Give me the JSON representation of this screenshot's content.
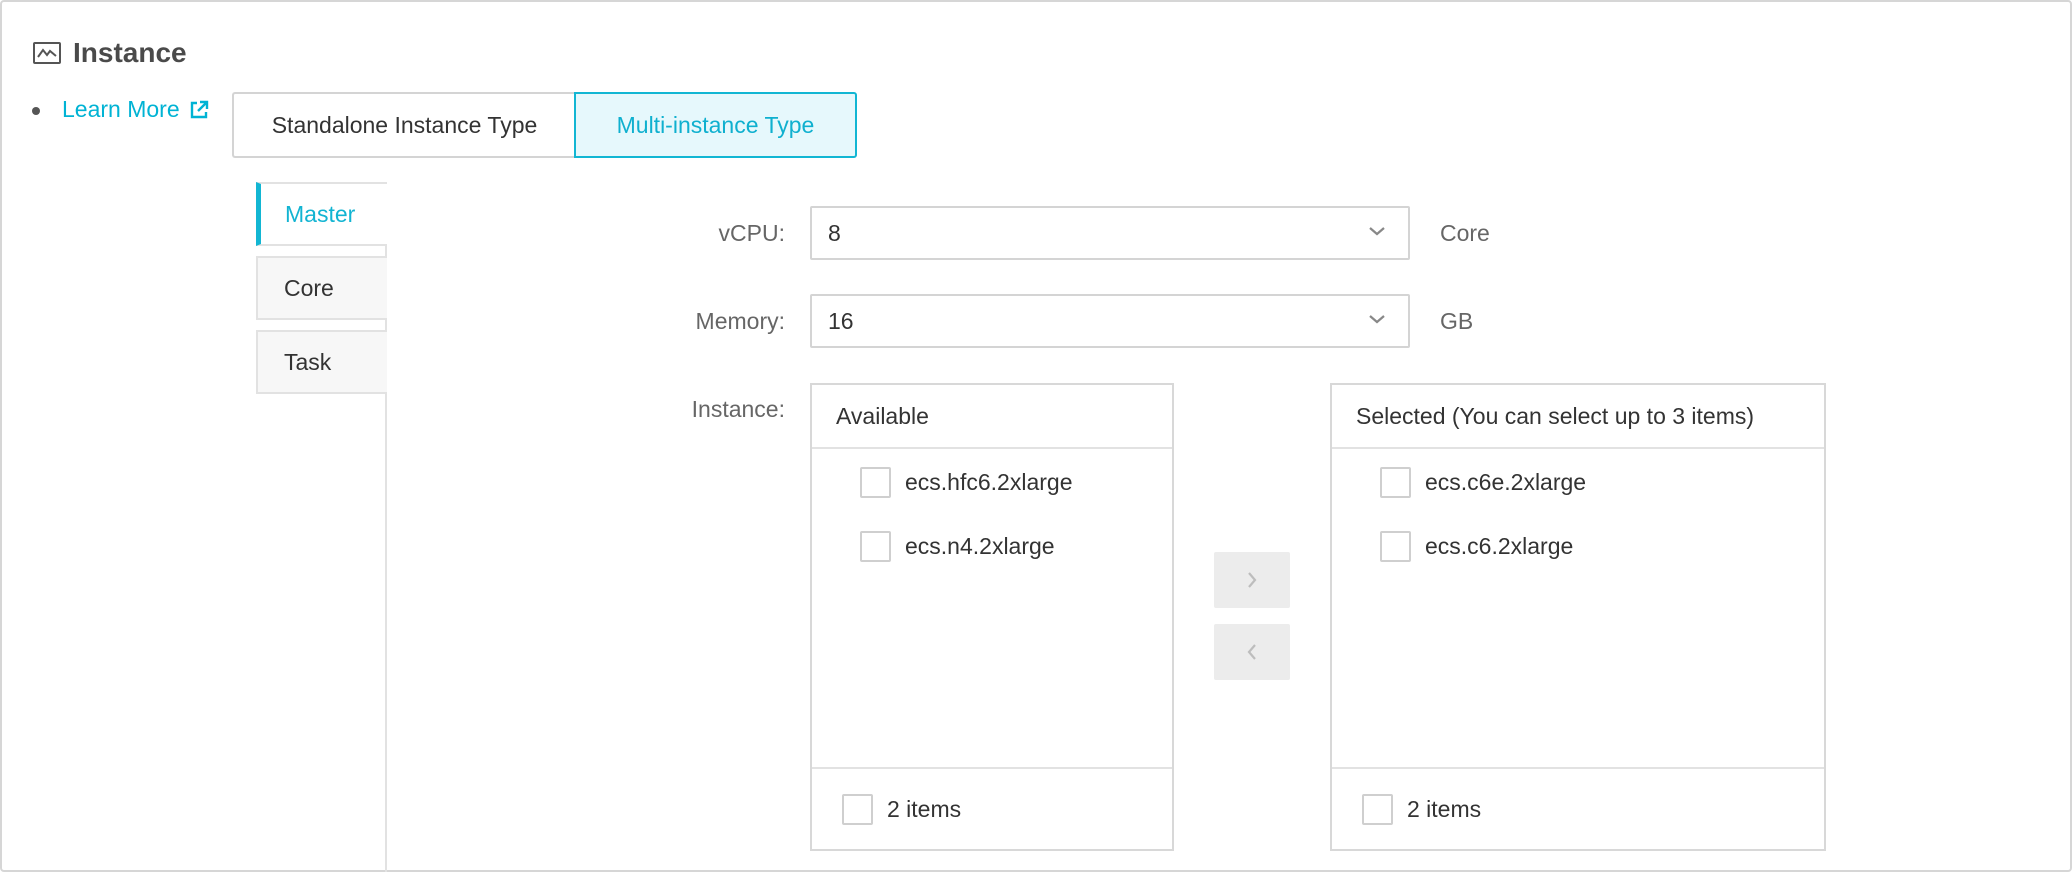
{
  "header": {
    "title": "Instance",
    "icon": "monitor-chart-icon"
  },
  "learn_more": {
    "label": "Learn More",
    "icon": "external-link-icon"
  },
  "type_switch": {
    "options": [
      "Standalone Instance Type",
      "Multi-instance Type"
    ],
    "selected": "Multi-instance Type"
  },
  "node_tabs": {
    "items": [
      "Master",
      "Core",
      "Task"
    ],
    "active": "Master"
  },
  "form": {
    "vcpu": {
      "label": "vCPU:",
      "value": "8",
      "unit": "Core"
    },
    "memory": {
      "label": "Memory:",
      "value": "16",
      "unit": "GB"
    },
    "instance": {
      "label": "Instance:"
    }
  },
  "transfer": {
    "available": {
      "title": "Available",
      "items": [
        "ecs.hfc6.2xlarge",
        "ecs.n4.2xlarge"
      ],
      "footer": "2 items"
    },
    "selected": {
      "title": "Selected (You can select up to 3 items)",
      "items": [
        "ecs.c6e.2xlarge",
        "ecs.c6.2xlarge"
      ],
      "footer": "2 items"
    },
    "move_right_icon": "chevron-right-icon",
    "move_left_icon": "chevron-left-icon"
  },
  "colors": {
    "accent": "#12b6d3",
    "accent_bg": "#e6f8fc",
    "border": "#d4d4d4"
  }
}
